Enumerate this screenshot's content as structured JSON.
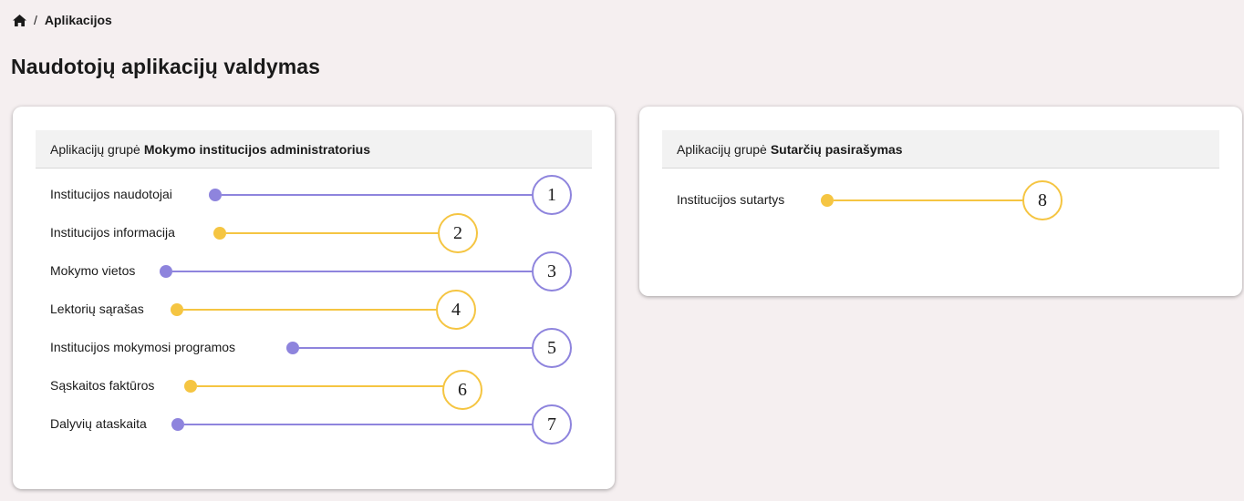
{
  "breadcrumb": {
    "home_icon": "home-icon",
    "separator": "/",
    "current": "Aplikacijos"
  },
  "page_title": "Naudotojų aplikacijų valdymas",
  "colors": {
    "purple": "#8e84dd",
    "yellow": "#f5c542"
  },
  "groups": [
    {
      "header_prefix": "Aplikacijų grupė",
      "header_name": "Mokymo institucijos administratorius",
      "items": [
        {
          "label": "Institucijos naudotojai",
          "marker": "1",
          "color": "purple"
        },
        {
          "label": "Institucijos informacija",
          "marker": "2",
          "color": "yellow"
        },
        {
          "label": "Mokymo vietos",
          "marker": "3",
          "color": "purple"
        },
        {
          "label": "Lektorių sąrašas",
          "marker": "4",
          "color": "yellow"
        },
        {
          "label": "Institucijos mokymosi programos",
          "marker": "5",
          "color": "purple"
        },
        {
          "label": "Sąskaitos faktūros",
          "marker": "6",
          "color": "yellow"
        },
        {
          "label": "Dalyvių ataskaita",
          "marker": "7",
          "color": "purple"
        }
      ]
    },
    {
      "header_prefix": "Aplikacijų grupė",
      "header_name": "Sutarčių pasirašymas",
      "items": [
        {
          "label": "Institucijos sutartys",
          "marker": "8",
          "color": "yellow"
        }
      ]
    }
  ]
}
